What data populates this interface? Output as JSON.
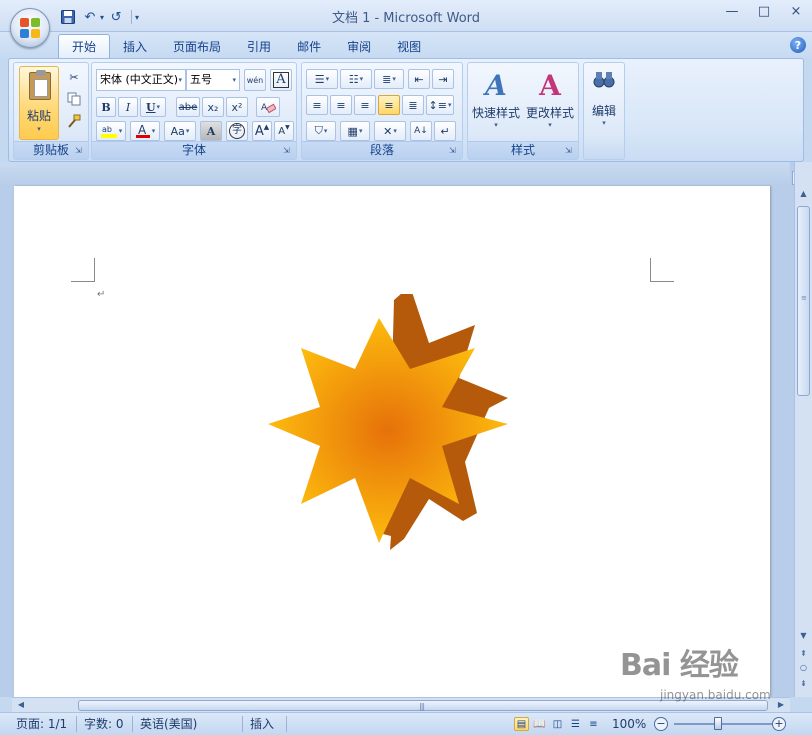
{
  "window": {
    "title": "文档 1 - Microsoft Word",
    "minimize": "—",
    "maximize": "□",
    "close": "×"
  },
  "qat": {
    "undo_glyph": "↶",
    "redo_glyph": "↺",
    "customize_glyph": "▾"
  },
  "tabs": [
    "开始",
    "插入",
    "页面布局",
    "引用",
    "邮件",
    "审阅",
    "视图"
  ],
  "active_tab": "开始",
  "help": "?",
  "ribbon": {
    "clipboard": {
      "label": "剪贴板",
      "paste_label": "粘贴"
    },
    "font": {
      "label": "字体",
      "font_name": "宋体 (中文正文)",
      "font_size": "五号",
      "bold": "B",
      "italic": "I",
      "underline": "U",
      "strike": "abe",
      "subscript": "x₂",
      "superscript": "x²",
      "grow": "A",
      "shrink": "A",
      "case": "Aa",
      "char_shade": "A",
      "enclose": "字",
      "clear_format": "A",
      "phonetic": "wén"
    },
    "paragraph": {
      "label": "段落"
    },
    "styles": {
      "label": "样式",
      "quick_styles": "快速样式",
      "change_styles": "更改样式"
    },
    "editing": {
      "label": "编辑"
    }
  },
  "document": {
    "paragraph_mark": "↵"
  },
  "status": {
    "page": "页面: 1/1",
    "words": "字数: 0",
    "language": "英语(美国)",
    "mode": "插入",
    "zoom": "100%",
    "zoom_out": "−",
    "zoom_in": "+"
  },
  "watermark": {
    "brand": "Bai 经验",
    "url": "jingyan.baidu.com"
  },
  "colors": {
    "star_outer": "#ffc20e",
    "star_center": "#e6710a",
    "star_side": "#b55a0b",
    "ribbon_blue": "#dbe8f8"
  }
}
